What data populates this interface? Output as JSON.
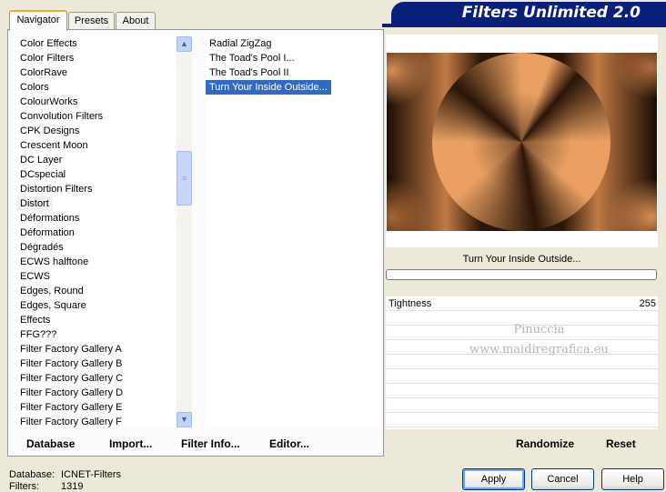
{
  "tabs": [
    "Navigator",
    "Presets",
    "About"
  ],
  "banner_title": "Filters Unlimited 2.0",
  "categories": [
    "Color Effects",
    "Color Filters",
    "ColorRave",
    "Colors",
    "ColourWorks",
    "Convolution Filters",
    "CPK Designs",
    "Crescent Moon",
    "DC Layer",
    "DCspecial",
    "Distortion Filters",
    "Distort",
    "Déformations",
    "Déformation",
    "Dégradés",
    "ECWS halftone",
    "ECWS",
    "Edges, Round",
    "Edges, Square",
    "Effects",
    "FFG???",
    "Filter Factory Gallery A",
    "Filter Factory Gallery B",
    "Filter Factory Gallery C",
    "Filter Factory Gallery D",
    "Filter Factory Gallery E",
    "Filter Factory Gallery F"
  ],
  "selected_category": "Distort",
  "filters": [
    "Radial ZigZag",
    "The Toad's Pool I...",
    "The Toad's Pool II",
    "Turn Your Inside Outside..."
  ],
  "selected_filter": "Turn Your Inside Outside...",
  "toolbar": {
    "database": "Database",
    "import": "Import...",
    "filter_info": "Filter Info...",
    "editor": "Editor..."
  },
  "preview_filter_name": "Turn Your Inside Outside...",
  "params": [
    {
      "label": "Tightness",
      "value": "255"
    }
  ],
  "watermark": [
    "Pinuccia",
    "www.maidiregrafica.eu"
  ],
  "right_toolbar": {
    "randomize": "Randomize",
    "reset": "Reset"
  },
  "info": {
    "database_label": "Database:",
    "database_value": "ICNET-Filters",
    "filters_label": "Filters:",
    "filters_value": "1319"
  },
  "buttons": {
    "apply": "Apply",
    "cancel": "Cancel",
    "help": "Help"
  }
}
